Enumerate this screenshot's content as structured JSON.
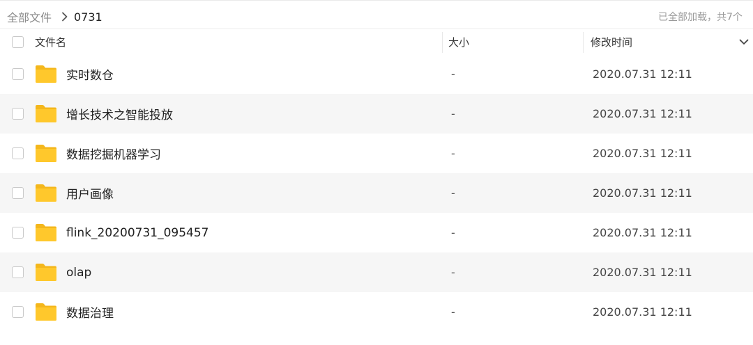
{
  "breadcrumb": {
    "root": "全部文件",
    "current": "0731"
  },
  "status": "已全部加载，共7个",
  "columns": {
    "name": "文件名",
    "size": "大小",
    "modified": "修改时间"
  },
  "icons": {
    "folder": "folder-icon",
    "separator": "chevron-right-icon",
    "sort": "chevron-down-icon"
  },
  "colors": {
    "folder": "#FFC82C",
    "folder_tab": "#F4B71C",
    "alt_row": "#f6f6f6"
  },
  "files": [
    {
      "name": "实时数仓",
      "size": "-",
      "modified": "2020.07.31 12:11"
    },
    {
      "name": "增长技术之智能投放",
      "size": "-",
      "modified": "2020.07.31 12:11"
    },
    {
      "name": "数据挖掘机器学习",
      "size": "-",
      "modified": "2020.07.31 12:11"
    },
    {
      "name": "用户画像",
      "size": "-",
      "modified": "2020.07.31 12:11"
    },
    {
      "name": "flink_20200731_095457",
      "size": "-",
      "modified": "2020.07.31 12:11"
    },
    {
      "name": "olap",
      "size": "-",
      "modified": "2020.07.31 12:11"
    },
    {
      "name": "数据治理",
      "size": "-",
      "modified": "2020.07.31 12:11"
    }
  ]
}
